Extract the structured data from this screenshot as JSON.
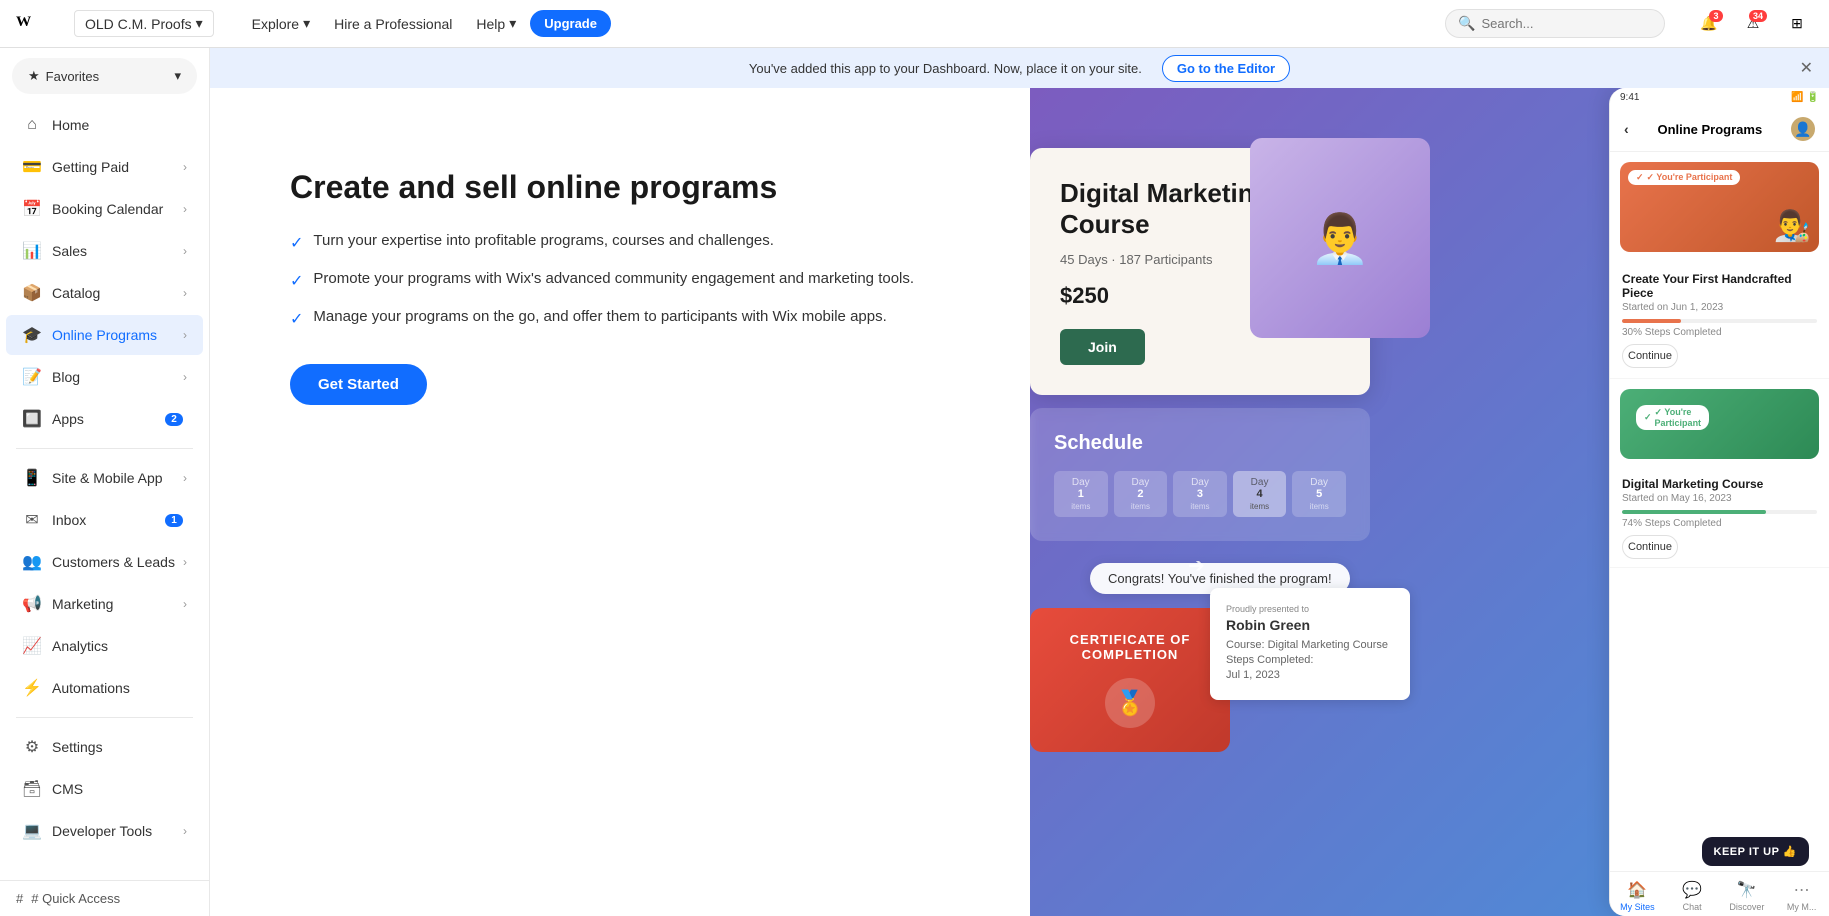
{
  "topnav": {
    "logo": "W",
    "site_name": "OLD C.M. Proofs",
    "explore": "Explore",
    "hire": "Hire a Professional",
    "help": "Help",
    "upgrade": "Upgrade",
    "search_placeholder": "Search...",
    "notification_badge": "3",
    "alert_badge": "34"
  },
  "announcement": {
    "text": "You've added this app to your Dashboard. Now, place it on your site.",
    "cta": "Go to the Editor"
  },
  "sidebar": {
    "favorites_label": "Favorites",
    "items": [
      {
        "id": "home",
        "label": "Home",
        "icon": "⌂",
        "has_arrow": false
      },
      {
        "id": "getting-paid",
        "label": "Getting Paid",
        "icon": "💳",
        "has_arrow": true
      },
      {
        "id": "booking-calendar",
        "label": "Booking Calendar",
        "icon": "📅",
        "has_arrow": true
      },
      {
        "id": "sales",
        "label": "Sales",
        "icon": "📊",
        "has_arrow": true
      },
      {
        "id": "catalog",
        "label": "Catalog",
        "icon": "📦",
        "has_arrow": true
      },
      {
        "id": "online-programs",
        "label": "Online Programs",
        "icon": "🎓",
        "has_arrow": true,
        "active": true
      },
      {
        "id": "blog",
        "label": "Blog",
        "icon": "📝",
        "has_arrow": true
      },
      {
        "id": "apps",
        "label": "Apps",
        "icon": "🔲",
        "has_arrow": false,
        "badge": "2"
      },
      {
        "id": "site-mobile",
        "label": "Site & Mobile App",
        "icon": "📱",
        "has_arrow": true
      },
      {
        "id": "inbox",
        "label": "Inbox",
        "icon": "✉",
        "has_arrow": false,
        "badge": "1"
      },
      {
        "id": "customers-leads",
        "label": "Customers & Leads",
        "icon": "👥",
        "has_arrow": true
      },
      {
        "id": "marketing",
        "label": "Marketing",
        "icon": "📢",
        "has_arrow": true
      },
      {
        "id": "analytics",
        "label": "Analytics",
        "icon": "📈",
        "has_arrow": false
      },
      {
        "id": "automations",
        "label": "Automations",
        "icon": "⚡",
        "has_arrow": false
      },
      {
        "id": "settings",
        "label": "Settings",
        "icon": "⚙",
        "has_arrow": false
      },
      {
        "id": "cms",
        "label": "CMS",
        "icon": "🗃",
        "has_arrow": false
      },
      {
        "id": "developer-tools",
        "label": "Developer Tools",
        "icon": "💻",
        "has_arrow": true
      }
    ],
    "quick_access": "# Quick Access"
  },
  "feature": {
    "title": "Create and sell online programs",
    "bullets": [
      "Turn your expertise into profitable programs, courses and challenges.",
      "Promote your programs with Wix's advanced community engagement and marketing tools.",
      "Manage your programs on the go, and offer them to participants with Wix mobile apps."
    ],
    "cta": "Get Started"
  },
  "preview": {
    "course_title": "Digital Marketing Course",
    "course_meta": "45 Days · 187 Participants",
    "course_price": "$250",
    "join_btn": "Join",
    "schedule_title": "Schedule",
    "days": [
      "Day 1",
      "Day 2",
      "Day 3",
      "Day 4",
      "Day 5"
    ],
    "congrats": "Congrats! You've finished the program!",
    "cert_title": "CERTIFICATE OF COMPLETION",
    "robin_name": "Robin Green",
    "mobile_header": "Online Programs",
    "mobile_course1": "Create Your First Handcrafted Piece",
    "mobile_course1_date": "Started on Jun 1, 2023",
    "mobile_course1_progress": "30% Steps Completed",
    "mobile_progress1_pct": 30,
    "mobile_continue": "Continue",
    "mobile_course2": "Digital Marketing Course",
    "mobile_course2_date": "Started on May 16, 2023",
    "mobile_course2_progress": "74% Steps Completed",
    "mobile_progress2_pct": 74,
    "mobile_nav": [
      "My Sites",
      "Chat",
      "Discover",
      "My M..."
    ],
    "keepitup": "KEEP IT UP 👍",
    "participant_badge": "✓ You're Participant",
    "presented_to": "Proudly presented to",
    "course_label": "Course:",
    "steps_label": "Steps Completed:",
    "date_label": "Jul 1, 2023"
  }
}
